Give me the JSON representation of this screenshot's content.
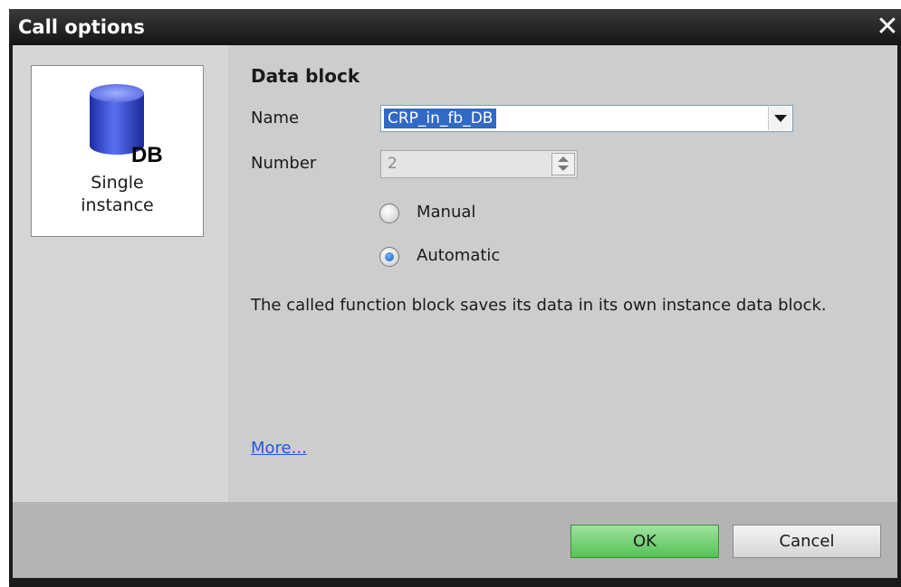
{
  "window": {
    "title": "Call options"
  },
  "left_panel": {
    "card_label_line1": "Single",
    "card_label_line2": "instance",
    "db_icon_text": "DB"
  },
  "data_block": {
    "section_title": "Data block",
    "name_label": "Name",
    "name_value": "CRP_in_fb_DB",
    "number_label": "Number",
    "number_value": "2",
    "radio_manual": "Manual",
    "radio_automatic": "Automatic",
    "selected_mode": "Automatic",
    "description": "The called function block saves its data in its own instance data block.",
    "more_link": "More..."
  },
  "footer": {
    "ok_label": "OK",
    "cancel_label": "Cancel"
  },
  "colors": {
    "selection": "#3169c6",
    "ok_button": "#56c256",
    "link": "#1f5bd6"
  }
}
